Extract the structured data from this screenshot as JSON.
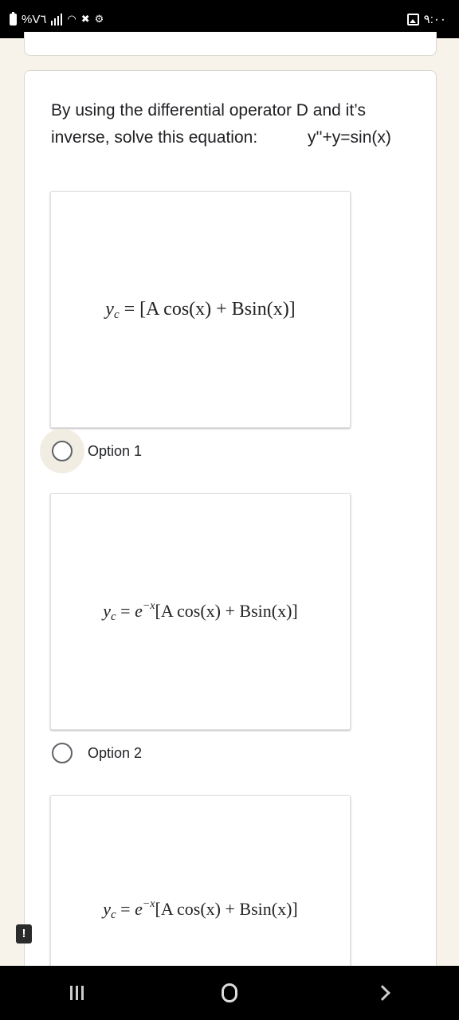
{
  "status_bar": {
    "left_text": "%V٦",
    "time": "٩:٠٠",
    "icons": [
      "battery-icon",
      "signal-bars-icon",
      "wifi-icon",
      "bluetooth-icon",
      "settings-icon",
      "gallery-icon"
    ]
  },
  "question": {
    "text": "By using the differential operator D and it’s inverse, solve this equation:",
    "equation": "y''+y=sin(x)"
  },
  "options": [
    {
      "label": "Option 1",
      "formula": {
        "lhs": "y",
        "sub": "c",
        "eq": " = ",
        "exp_base": "",
        "exp": "",
        "rhs": "[A cos(x) + Bsin(x)]"
      },
      "hovered": true,
      "selected": false
    },
    {
      "label": "Option 2",
      "formula": {
        "lhs": "y",
        "sub": "c",
        "eq": " = ",
        "exp_base": "e",
        "exp": "−x",
        "rhs": "[A cos(x) + Bsin(x)]"
      },
      "hovered": false,
      "selected": false
    },
    {
      "label": "",
      "formula": {
        "lhs": "y",
        "sub": "c",
        "eq": " = ",
        "exp_base": "e",
        "exp": "−x",
        "rhs": "[A cos(x) + Bsin(x)]"
      },
      "hovered": false,
      "selected": false
    }
  ],
  "side_alert": "!",
  "nav_bar": {
    "buttons": [
      "recents",
      "home",
      "back"
    ]
  }
}
